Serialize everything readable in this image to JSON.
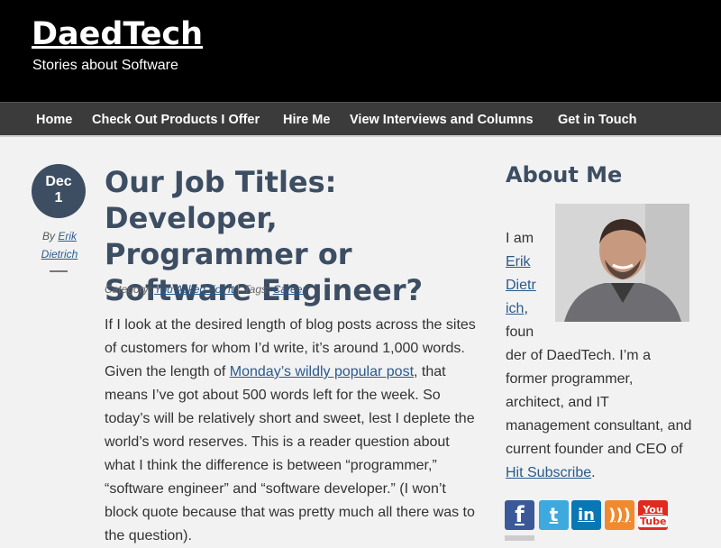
{
  "site": {
    "title": "DaedTech",
    "tagline": "Stories about Software"
  },
  "nav": {
    "items": [
      {
        "label": "Home"
      },
      {
        "label": "Check Out Products I Offer"
      },
      {
        "label": "Hire Me"
      },
      {
        "label": "View Interviews and Columns"
      },
      {
        "label": "Get in Touch"
      }
    ]
  },
  "post": {
    "date_month": "Dec",
    "date_day": "1",
    "by_prefix": "By",
    "author_first": "Erik",
    "author_last": "Dietrich",
    "title": "Our Job Titles: Developer, Programmer or Software Engineer?",
    "category_label": "Category:",
    "category": "You Asked For It",
    "tags_label": "Tags:",
    "tag": "Career",
    "p1": "If I look at the desired length of blog posts across the sites of customers for whom I’d write, it’s around 1,000 words.  Given the length of ",
    "p1_link": "Monday’s wildly popular post",
    "p2": ", that means I’ve got about 500 words left for the week.  So today’s will be relatively short and sweet, lest I deplete the world’s word reserves.  This is a reader question about what I think the difference is between “programmer,” “software engineer” and “software developer.”  (I won’t block quote because that was pretty much all there was to the question)."
  },
  "sidebar": {
    "about_title": "About Me",
    "about_i_am": "I am",
    "about_name_1": "Erik",
    "about_name_2": "Dietr",
    "about_name_3": "ich",
    "about_comma": ",",
    "about_foun": "foun",
    "about_rest": "der of DaedTech. I’m a former programmer, architect, and IT management consultant, and current founder and CEO of ",
    "about_link": "Hit Subscribe",
    "about_end": ".",
    "social": {
      "facebook": "f",
      "twitter": "t",
      "linkedin": "in",
      "rss": ")))",
      "youtube_you": "You",
      "youtube_tube": "Tube"
    }
  },
  "colors": {
    "header_bg": "#000000",
    "nav_bg": "#3b3b3b",
    "accent": "#3d4e63",
    "link": "#2a5a8c",
    "page_bg": "#f2f2f2"
  }
}
